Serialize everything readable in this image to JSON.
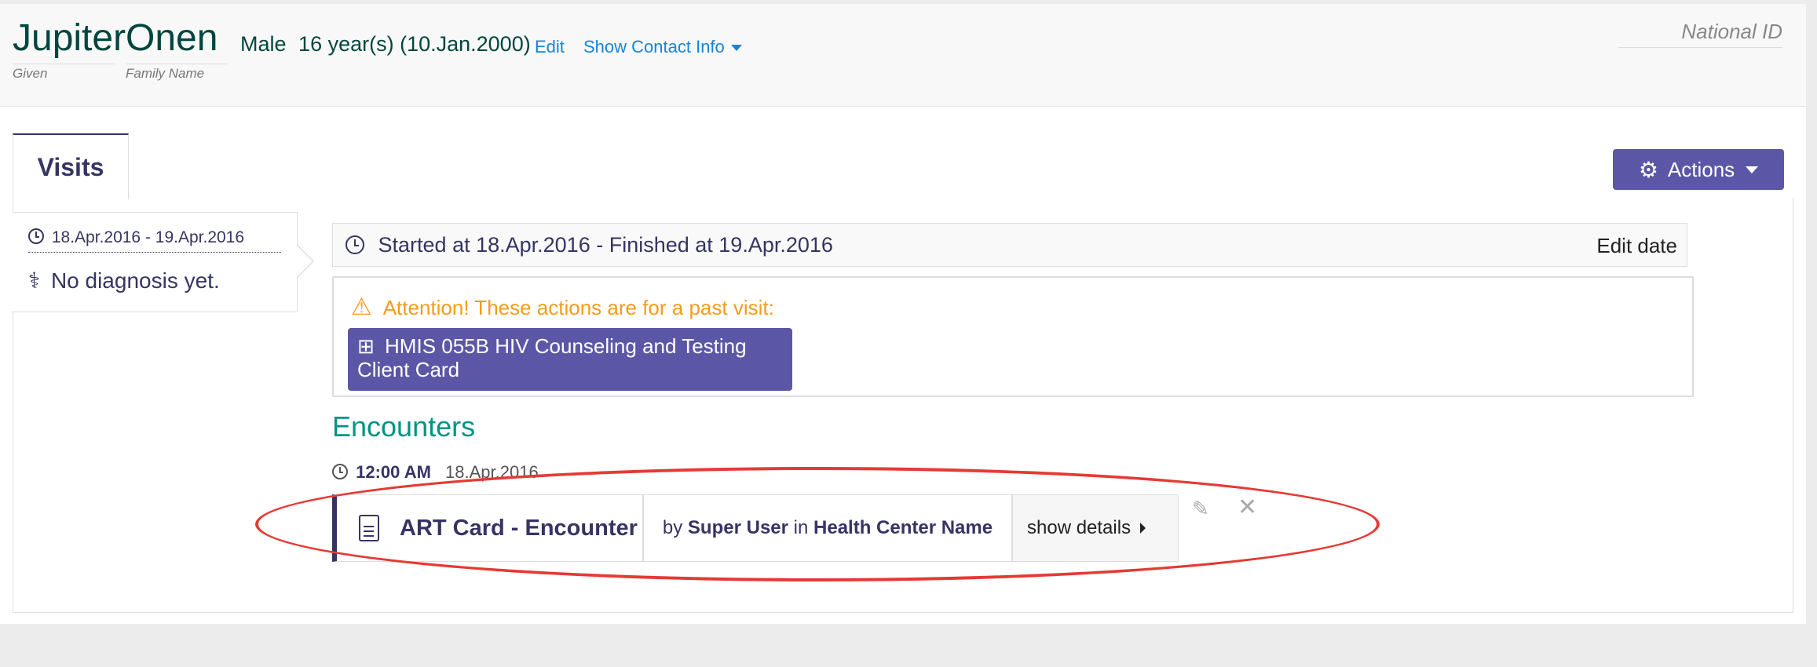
{
  "patient": {
    "given_name": "Jupiter",
    "family_name": "Onen",
    "given_caption": "Given",
    "family_caption": "Family Name",
    "gender": "Male",
    "age_dob": "16 year(s) (10.Jan.2000)",
    "edit_label": "Edit",
    "contact_label": "Show Contact Info",
    "national_id_label": "National ID"
  },
  "tabs": {
    "visits_label": "Visits",
    "actions_label": "Actions"
  },
  "visit_list": {
    "dates": "18.Apr.2016 - 19.Apr.2016",
    "diagnosis": "No diagnosis yet."
  },
  "visit_details": {
    "summary": "Started at 18.Apr.2016 - Finished at 19.Apr.2016",
    "edit_date_label": "Edit date",
    "attention": "Attention! These actions are for a past visit:",
    "form_button_label": "HMIS 055B HIV Counseling and Testing Client Card"
  },
  "encounters": {
    "heading": "Encounters",
    "time": "12:00 AM",
    "date": "18.Apr.2016",
    "items": [
      {
        "name": "ART Card - Encounter",
        "by_label": "by",
        "provider": "Super User",
        "in_label": "in",
        "location": "Health Center Name",
        "details_label": "show details"
      }
    ]
  },
  "colors": {
    "brand_purple": "#5b57a6",
    "heading_teal": "#009384",
    "warning_orange": "#f59c1a",
    "link_blue": "#1584d8",
    "annotation_red": "#e53a34"
  },
  "icons": [
    "clock-icon",
    "stethoscope-icon",
    "warning-icon",
    "medkit-icon",
    "document-icon",
    "pencil-icon",
    "close-icon",
    "gear-icon",
    "caret-down-icon",
    "caret-right-icon"
  ]
}
